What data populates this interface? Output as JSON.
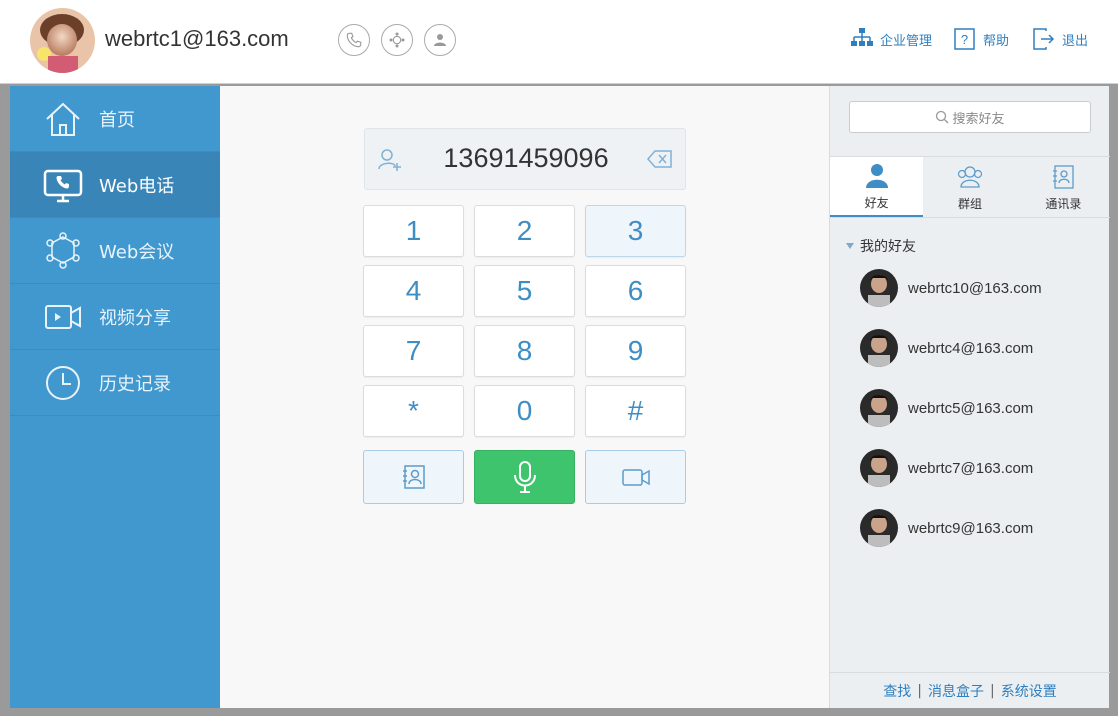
{
  "header": {
    "user_email": "webrtc1@163.com",
    "links": [
      {
        "label": "企业管理",
        "icon": "org-chart-icon"
      },
      {
        "label": "帮助",
        "icon": "help-icon"
      },
      {
        "label": "退出",
        "icon": "logout-icon"
      }
    ],
    "circle_icons": [
      "phone-icon",
      "conference-icon",
      "contact-icon"
    ]
  },
  "sidebar": {
    "items": [
      {
        "label": "首页",
        "icon": "home-icon",
        "active": false
      },
      {
        "label": "Web电话",
        "icon": "web-phone-icon",
        "active": true
      },
      {
        "label": "Web会议",
        "icon": "web-conference-icon",
        "active": false
      },
      {
        "label": "视频分享",
        "icon": "video-share-icon",
        "active": false
      },
      {
        "label": "历史记录",
        "icon": "history-clock-icon",
        "active": false
      }
    ]
  },
  "dialer": {
    "number": "13691459096",
    "keys": [
      "1",
      "2",
      "3",
      "4",
      "5",
      "6",
      "7",
      "8",
      "9",
      "*",
      "0",
      "#"
    ],
    "highlighted_key": "3",
    "actions": [
      "contacts-book-icon",
      "microphone-icon",
      "video-camera-icon"
    ]
  },
  "right_panel": {
    "search_placeholder": "搜索好友",
    "tabs": [
      {
        "label": "好友",
        "icon": "friend-icon",
        "active": true
      },
      {
        "label": "群组",
        "icon": "group-icon",
        "active": false
      },
      {
        "label": "通讯录",
        "icon": "address-book-icon",
        "active": false
      }
    ],
    "group_title": "我的好友",
    "friends": [
      {
        "email": "webrtc10@163.com"
      },
      {
        "email": "webrtc4@163.com"
      },
      {
        "email": "webrtc5@163.com"
      },
      {
        "email": "webrtc7@163.com"
      },
      {
        "email": "webrtc9@163.com"
      }
    ],
    "footer": {
      "find": "查找",
      "message_box": "消息盒子",
      "settings": "系统设置",
      "separator": "|"
    }
  },
  "colors": {
    "sidebar_bg": "#4198cf",
    "sidebar_active": "#3a85b8",
    "accent_blue": "#3e8dc4",
    "call_green": "#3ec46c"
  }
}
